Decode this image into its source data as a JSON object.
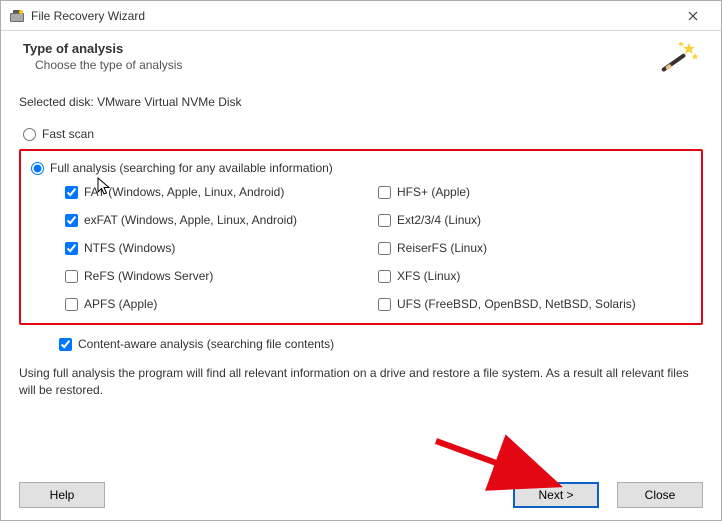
{
  "window": {
    "title": "File Recovery Wizard"
  },
  "header": {
    "heading": "Type of analysis",
    "subheading": "Choose the type of analysis"
  },
  "selected_disk": {
    "label": "Selected disk:",
    "value": "VMware Virtual NVMe Disk"
  },
  "scan_modes": {
    "fast": {
      "label": "Fast scan",
      "checked": false
    },
    "full": {
      "label": "Full analysis (searching for any available information)",
      "checked": true
    }
  },
  "filesystems_left": [
    {
      "id": "fat",
      "label": "FAT (Windows, Apple, Linux, Android)",
      "checked": true
    },
    {
      "id": "exfat",
      "label": "exFAT (Windows, Apple, Linux, Android)",
      "checked": true
    },
    {
      "id": "ntfs",
      "label": "NTFS (Windows)",
      "checked": true
    },
    {
      "id": "refs",
      "label": "ReFS (Windows Server)",
      "checked": false
    },
    {
      "id": "apfs",
      "label": "APFS (Apple)",
      "checked": false
    }
  ],
  "filesystems_right": [
    {
      "id": "hfs",
      "label": "HFS+ (Apple)",
      "checked": false
    },
    {
      "id": "ext",
      "label": "Ext2/3/4 (Linux)",
      "checked": false
    },
    {
      "id": "reiser",
      "label": "ReiserFS (Linux)",
      "checked": false
    },
    {
      "id": "xfs",
      "label": "XFS (Linux)",
      "checked": false
    },
    {
      "id": "ufs",
      "label": "UFS (FreeBSD, OpenBSD, NetBSD, Solaris)",
      "checked": false
    }
  ],
  "content_aware": {
    "label": "Content-aware analysis (searching file contents)",
    "checked": true
  },
  "info_text": "Using full analysis the program will find all relevant information on a drive and restore a file system. As a result all relevant files will be restored.",
  "buttons": {
    "help": "Help",
    "next": "Next >",
    "close": "Close"
  }
}
